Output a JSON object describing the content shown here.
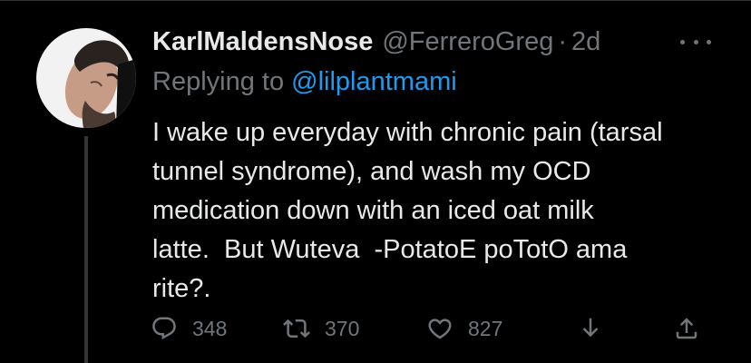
{
  "tweet": {
    "display_name": "KarlMaldensNose",
    "handle": "@FerreroGreg",
    "separator": "·",
    "time": "2d",
    "replying_prefix": "Replying to ",
    "replying_to": "@lilplantmami",
    "text": "I wake up everyday with chronic pain (tarsal\ntunnel syndrome), and wash my OCD\nmedication down with an iced oat milk\nlatte.  But Wuteva  -PotatoE poTotO ama\nrite?."
  },
  "actions": {
    "reply_count": "348",
    "retweet_count": "370",
    "like_count": "827"
  },
  "icons": {
    "more": "more-horizontal-icon",
    "reply": "reply-icon",
    "retweet": "retweet-icon",
    "like": "heart-icon",
    "download": "download-icon",
    "share": "share-icon"
  },
  "colors": {
    "background": "#000000",
    "primary_text": "#e7e9ea",
    "secondary_text": "#71767b",
    "link": "#1d9bf0",
    "thread_line": "#333639"
  }
}
